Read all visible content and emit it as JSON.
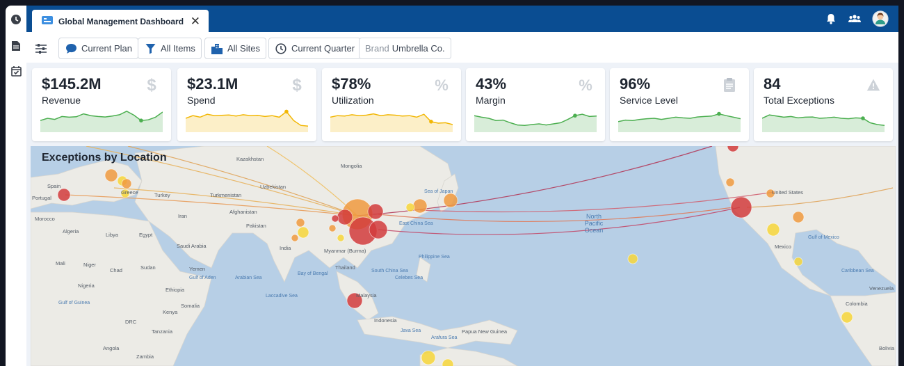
{
  "window": {
    "tab_title": "Global Management Dashboard",
    "tab_close": "✕"
  },
  "rail_icons": [
    "clock-icon",
    "document-icon",
    "calendar-check-icon"
  ],
  "topbar_icons": [
    "bell-icon",
    "users-icon",
    "avatar"
  ],
  "toolbar": {
    "filters_icon": "sliders-icon",
    "buttons": [
      {
        "label": "Current Plan",
        "icon": "chat-bubble-icon"
      },
      {
        "label": "All Items",
        "icon": "filter-icon"
      },
      {
        "label": "All Sites",
        "icon": "buildings-icon"
      },
      {
        "label": "Current Quarter",
        "icon": "clock-icon"
      }
    ],
    "brand_prefix": "Brand",
    "brand_name": "Umbrella Co."
  },
  "kpis": [
    {
      "value": "$145.2M",
      "label": "Revenue",
      "icon": "dollar-icon",
      "color": "#4caf50",
      "spark": [
        0.4,
        0.5,
        0.45,
        0.58,
        0.55,
        0.57,
        0.7,
        0.62,
        0.58,
        0.56,
        0.6,
        0.66,
        0.82,
        0.64,
        0.4,
        0.43,
        0.55,
        0.78
      ]
    },
    {
      "value": "$23.1M",
      "label": "Spend",
      "icon": "dollar-icon",
      "color": "#f2b705",
      "spark": [
        0.5,
        0.62,
        0.55,
        0.68,
        0.62,
        0.63,
        0.65,
        0.6,
        0.66,
        0.62,
        0.63,
        0.58,
        0.62,
        0.55,
        0.8,
        0.4,
        0.18,
        0.15
      ]
    },
    {
      "value": "$78%",
      "label": "Utilization",
      "icon": "percent-icon",
      "color": "#f2b705",
      "spark": [
        0.55,
        0.62,
        0.6,
        0.66,
        0.62,
        0.64,
        0.7,
        0.62,
        0.66,
        0.64,
        0.6,
        0.62,
        0.55,
        0.68,
        0.35,
        0.28,
        0.3,
        0.22
      ]
    },
    {
      "value": "43%",
      "label": "Margin",
      "icon": "percent-icon",
      "color": "#4caf50",
      "spark": [
        0.62,
        0.55,
        0.5,
        0.4,
        0.42,
        0.3,
        0.2,
        0.18,
        0.22,
        0.25,
        0.2,
        0.25,
        0.3,
        0.45,
        0.62,
        0.68,
        0.58,
        0.6
      ]
    },
    {
      "value": "96%",
      "label": "Service Level",
      "icon": "clipboard-icon",
      "color": "#4caf50",
      "spark": [
        0.35,
        0.42,
        0.4,
        0.45,
        0.48,
        0.5,
        0.45,
        0.5,
        0.55,
        0.52,
        0.5,
        0.56,
        0.58,
        0.6,
        0.7,
        0.62,
        0.55,
        0.48
      ]
    },
    {
      "value": "84",
      "label": "Total Exceptions",
      "icon": "warning-icon",
      "color": "#4caf50",
      "spark": [
        0.5,
        0.65,
        0.6,
        0.55,
        0.58,
        0.52,
        0.55,
        0.56,
        0.5,
        0.52,
        0.55,
        0.5,
        0.48,
        0.52,
        0.5,
        0.3,
        0.22,
        0.18
      ]
    }
  ],
  "map": {
    "title": "Exceptions by Location",
    "colors": {
      "water": "#b7cfe6",
      "land": "#ecebe6",
      "high": "#d23c3c",
      "medium": "#f09a3e",
      "low": "#f7d63a"
    },
    "ocean_labels": [
      "North Pacific Ocean",
      "Sea of Japan",
      "East China Sea",
      "Philippine Sea",
      "South China Sea",
      "Bay of Bengal",
      "Arabian Sea",
      "Gulf of Aden",
      "Laccadive Sea",
      "Gulf of Guinea",
      "Celebes Sea",
      "Gulf of Mexico",
      "Caribbean Sea",
      "Arafura Sea",
      "Java Sea"
    ],
    "place_labels": [
      "Spain",
      "Portugal",
      "Morocco",
      "Algeria",
      "Libya",
      "Egypt",
      "Mali",
      "Niger",
      "Chad",
      "Sudan",
      "Nigeria",
      "Ethiopia",
      "Somalia",
      "Kenya",
      "DRC",
      "Tanzania",
      "Angola",
      "Zambia",
      "Turkey",
      "Turkmenistan",
      "Afghanistan",
      "Pakistan",
      "India",
      "Iran",
      "Saudi Arabia",
      "Yemen",
      "Kazakhstan",
      "Uzbekistan",
      "Mongolia",
      "Myanmar (Burma)",
      "Thailand",
      "Malaysia",
      "Indonesia",
      "Papua New Guinea",
      "United States",
      "Mexico",
      "Colombia",
      "Venezuela",
      "Bolivia",
      "Greece"
    ]
  }
}
